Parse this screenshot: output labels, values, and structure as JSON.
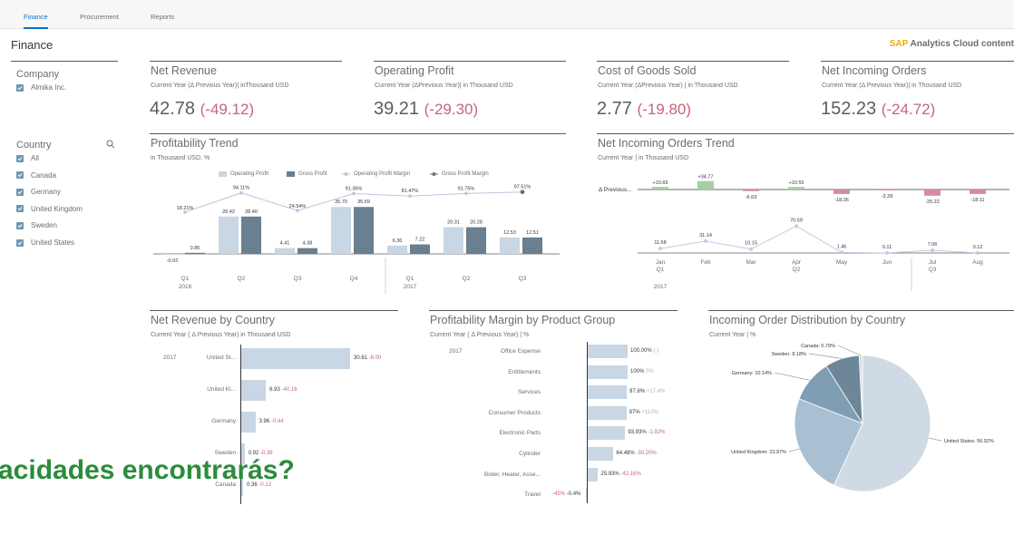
{
  "tabs": [
    {
      "label": "Finance"
    },
    {
      "label": "Procurement"
    },
    {
      "label": "Reports"
    }
  ],
  "page_title": "Finance",
  "brand": {
    "prefix": "SAP",
    "suffix": " Analytics Cloud content"
  },
  "filters": {
    "company": {
      "title": "Company",
      "items": [
        "Almika Inc."
      ]
    },
    "country": {
      "title": "Country",
      "items": [
        "All",
        "Canada",
        "Germany",
        "United Kingdom",
        "Sweden",
        "United States"
      ]
    }
  },
  "kpis": [
    {
      "title": "Net Revenue",
      "subtitle": "Current Year (Δ Previous Year)| inThousand USD",
      "value": "42.78",
      "delta": "(-49.12)"
    },
    {
      "title": "Operating Profit",
      "subtitle": "Current Year (ΔPrevious Year)| in Thousand USD",
      "value": "39.21",
      "delta": "(-29.30)"
    },
    {
      "title": "Cost of Goods Sold",
      "subtitle": "Current Year (ΔPrevious Year) | in Thousand USD",
      "value": "2.77",
      "delta": "(-19.80)"
    },
    {
      "title": "Net Incoming Orders",
      "subtitle": "Current Year (Δ Previous Year)| in Thousand USD",
      "value": "152.23",
      "delta": "(-24.72)"
    }
  ],
  "profitability": {
    "title": "Profitability Trend",
    "subtitle": "in Thousand USD, %",
    "legend": [
      "Operating Profit",
      "Gross Profit",
      "Operating Profit Margin",
      "Gross Profit Margin"
    ],
    "colors": {
      "op": "#c9d6e3",
      "gp": "#6a7f8f",
      "opm": "#b9c6dc",
      "gpm": "#5f7282"
    },
    "chart_data": {
      "type": "bar",
      "categories": [
        "Q1 2016",
        "Q2 2016",
        "Q3 2016",
        "Q4 2016",
        "Q1 2017",
        "Q2 2017",
        "Q3 2017"
      ],
      "x_quarters": [
        "Q1",
        "Q2",
        "Q3",
        "Q4",
        "Q1",
        "Q2",
        "Q3"
      ],
      "x_years": [
        "2016",
        "",
        "",
        "",
        "2017",
        "",
        ""
      ],
      "series": [
        {
          "name": "Operating Profit",
          "values": [
            -0.02,
            28.42,
            4.41,
            35.7,
            6.36,
            20.31,
            12.53
          ]
        },
        {
          "name": "Gross Profit",
          "values": [
            0.85,
            28.4,
            4.38,
            35.69,
            7.22,
            20.28,
            12.51
          ]
        },
        {
          "name": "Operating Profit Margin",
          "values": [
            18.21,
            94.11,
            24.54,
            91.36,
            81.47,
            91.75,
            97.51
          ]
        },
        {
          "name": "Gross Profit Margin",
          "values": [
            null,
            null,
            null,
            null,
            null,
            null,
            97.51
          ]
        }
      ],
      "value_labels_op": [
        "-0.02",
        "28.42",
        "4.41",
        "35.70",
        "6.36",
        "20.31",
        "12.53"
      ],
      "value_labels_gp": [
        "0.85",
        "28.40",
        "4.38",
        "35.69",
        "7.22",
        "20.28",
        "12.51"
      ],
      "margin_labels": [
        "18.21%",
        "94.11%",
        "24.54%",
        "91.36%",
        "81.47%",
        "91.75%",
        "97.51%"
      ]
    }
  },
  "orders_trend": {
    "title": "Net Incoming Orders Trend",
    "subtitle": "Current Year | in Thousand USD",
    "row_label": "Δ Previous...",
    "chart_data": {
      "type": "line",
      "months": [
        "Jan",
        "Feb",
        "Mar",
        "Apr",
        "May",
        "Jun",
        "Jul",
        "Aug"
      ],
      "quarters": [
        "Q1",
        "",
        "",
        "Q2",
        "",
        "",
        "Q3",
        ""
      ],
      "year": "2017",
      "values": [
        11.58,
        31.14,
        10.15,
        70.59,
        1.46,
        0.11,
        7.06,
        0.12
      ],
      "value_labels": [
        "11.58",
        "31.14",
        "10.15",
        "70.59",
        "1.46",
        "0.11",
        "7.06",
        "0.12"
      ],
      "deltas": [
        10.69,
        34.77,
        -6.63,
        10.55,
        -18.36,
        -3.28,
        -25.22,
        -18.11
      ],
      "delta_labels": [
        "+10.69",
        "+34.77",
        "-6.63",
        "+10.55",
        "-18.36",
        "-3.28",
        "-25.22",
        "-18.11"
      ]
    }
  },
  "revenue_by_country": {
    "title": "Net Revenue by Country",
    "subtitle": "Current Year ( Δ Previous Year) in Thousand USD",
    "year": "2017",
    "chart_data": {
      "type": "bar",
      "categories": [
        "United St...",
        "United Ki...",
        "Germany",
        "Sweden",
        "Canada"
      ],
      "values": [
        30.61,
        6.93,
        3.96,
        0.92,
        0.36
      ],
      "value_labels": [
        "30.61",
        "6.93",
        "3.96",
        "0.92",
        "0.36"
      ],
      "delta_labels": [
        "-8.00",
        "-40.16",
        "-0.44",
        "-0.36",
        "-0.12"
      ]
    }
  },
  "margin_by_product": {
    "title": "Profitability Margin by Product Group",
    "subtitle": "Current Year ( Δ Previous Year) | %",
    "year": "2017",
    "chart_data": {
      "type": "bar",
      "categories": [
        "Office Expense",
        "Entitlements",
        "Services",
        "Consumer Products",
        "Electronic Parts",
        "Cylinder",
        "Boiler, Heater, Asse...",
        "Travel"
      ],
      "values": [
        100,
        100,
        97.8,
        97,
        93.93,
        64.48,
        25.93,
        -0.4
      ],
      "value_labels": [
        "100.00%",
        "100%",
        "97.8%",
        "97%",
        "93.93%",
        "64.48%",
        "25.93%",
        "-0.4%"
      ],
      "delta_labels": [
        "(-)",
        "0%",
        "+17.4%",
        "+112%",
        "-1.92%",
        "-30.20%",
        "-42.16%",
        "-45%"
      ]
    }
  },
  "order_distribution": {
    "title": "Incoming Order Distribution by Country",
    "subtitle": "Current Year | %",
    "chart_data": {
      "type": "pie",
      "labels": [
        "United States",
        "United Kingdom",
        "Germany",
        "Sweden",
        "Canada"
      ],
      "values": [
        56.92,
        23.97,
        10.14,
        8.18,
        0.79
      ],
      "slice_labels": [
        "United States: 56.92%",
        "United Kingdom: 23.97%",
        "Germany: 10.14%",
        "Sweden: 8.18%",
        "Canada: 0.79%"
      ],
      "colors": [
        "#cfdae5",
        "#a9c0d3",
        "#7f9eb4",
        "#6d8799",
        "#d6dfe8"
      ]
    }
  },
  "overlay_text": "acidades encontrarás?"
}
